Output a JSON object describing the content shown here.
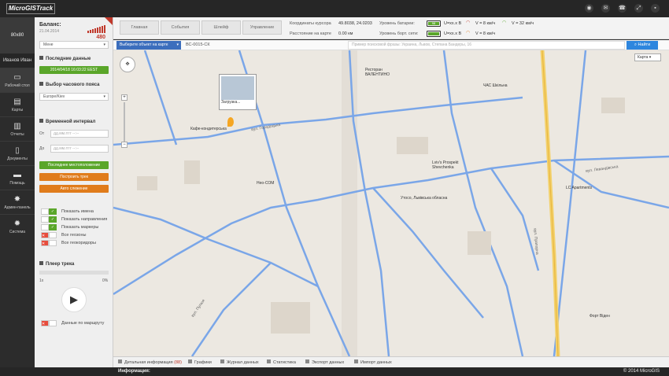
{
  "app": {
    "logo": "MicroGISTrack",
    "icons": [
      "settings-icon",
      "mail-icon",
      "phone-icon",
      "fullscreen-icon",
      "lock-icon"
    ]
  },
  "user": {
    "avatar_text": "80x80",
    "name": "Иванов Иван"
  },
  "nav": [
    {
      "name": "desktop",
      "label": "Рабочий стол",
      "icon": "monitor-icon",
      "glyph": "▭"
    },
    {
      "name": "maps",
      "label": "Карты",
      "icon": "book-icon",
      "glyph": "▤"
    },
    {
      "name": "reports",
      "label": "Отчеты",
      "icon": "chart-icon",
      "glyph": "▥"
    },
    {
      "name": "documents",
      "label": "Документы",
      "icon": "document-icon",
      "glyph": "▯"
    },
    {
      "name": "help",
      "label": "Помощь",
      "icon": "chat-icon",
      "glyph": "▬"
    },
    {
      "name": "admin",
      "label": "Админ-панель",
      "icon": "gear-icon",
      "glyph": "✸"
    },
    {
      "name": "system",
      "label": "Система",
      "icon": "cog-icon",
      "glyph": "✹"
    }
  ],
  "panel": {
    "balance_title": "Баланс:",
    "balance_date": "21.04.2014",
    "balance_amount": "480",
    "user_select": "Мене",
    "last_data_title": "Последние данные",
    "last_data_value": "2014/04/18 16:03:22 EEST",
    "timezone_title": "Выбор часового пояса",
    "timezone_value": "Europe/Kiev",
    "interval_title": "Временной интервал",
    "from_label": "От",
    "to_label": "До",
    "from_placeholder": "дд.мм.гггг --:--",
    "to_placeholder": "дд.мм.гггг --:--",
    "btn_last_location": "Последнее местоположение",
    "btn_build_track": "Построить трек",
    "btn_auto_follow": "Авто слежение",
    "toggles": [
      {
        "label": "Показать имена",
        "on": true
      },
      {
        "label": "Показать направления",
        "on": true
      },
      {
        "label": "Показать маркеры",
        "on": true
      },
      {
        "label": "Все геозоны",
        "on": false
      },
      {
        "label": "Все геокоридоры",
        "on": false
      }
    ],
    "track_player_title": "Плеер трека",
    "speed": "1x",
    "progress": "0%",
    "route_data_label": "Данные по маршруту"
  },
  "top": {
    "tabs": [
      "Главная",
      "События",
      "Шлейф",
      "Управление"
    ],
    "cursor_label": "Координаты курсора",
    "cursor_value": "49.8038, 24.0203",
    "distance_label": "Расстояние на карте",
    "distance_value": "0.00 км",
    "battery_label": "Уровень батареи:",
    "network_label": "Уровень борт. сети:",
    "battery_text": "98",
    "v1": "U=xx.x В",
    "v2": "U=xx.x В",
    "speed1": "V = 8 км/ч",
    "speed2": "V = 32 км/ч",
    "speed3": "V = 8 км/ч",
    "speed4": "V = 8 км/ч"
  },
  "search": {
    "object_select": "Выберите объект на карте",
    "object_value": "ВС-0015-СК",
    "query_placeholder": "Пример поисковой фразы: Украина, Львов, Степана Бандеры, 16",
    "find_button": "Найти"
  },
  "map": {
    "layer_select": "Карта",
    "popup_text": "Загрузка...",
    "labels": [
      "вул. Городоцька",
      "вул. Левандівська",
      "вул. Пулюя",
      "Неo-СОМ",
      "Lviv's Prospekt Shevchenka",
      "Утосо, Львівська обласна",
      "вул. Прапорна",
      "LC Apartments",
      "Ресторан ВАЛЕНТИНО",
      "Кафе-кондитерська",
      "ЧАС Шкільна",
      "Форт Віден"
    ]
  },
  "bottom_tabs": [
    {
      "label": "Детальная информация",
      "count": "(88)",
      "icon": "info-icon"
    },
    {
      "label": "Графики",
      "count": "",
      "icon": "chart-icon"
    },
    {
      "label": "Журнал данных",
      "count": "",
      "icon": "log-icon"
    },
    {
      "label": "Статистика",
      "count": "",
      "icon": "stats-icon"
    },
    {
      "label": "Экспорт данных",
      "count": "",
      "icon": "export-icon"
    },
    {
      "label": "Импорт данных",
      "count": "",
      "icon": "import-icon"
    }
  ],
  "footer": {
    "info_label": "Информация:",
    "copyright": "© 2014 MicroGIS"
  }
}
